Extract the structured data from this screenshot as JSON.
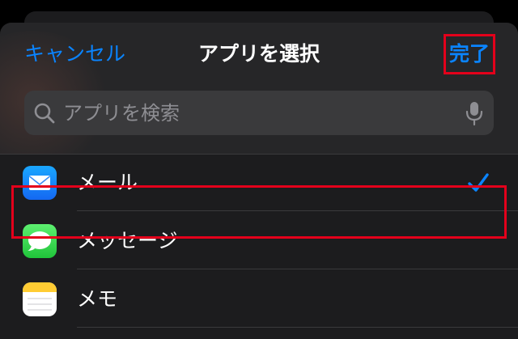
{
  "nav": {
    "cancel_label": "キャンセル",
    "title": "アプリを選択",
    "done_label": "完了"
  },
  "search": {
    "placeholder": "アプリを検索",
    "value": "",
    "icon": "search-icon",
    "mic_icon": "microphone-icon"
  },
  "apps": [
    {
      "label": "メール",
      "icon": "mail-app-icon",
      "selected": true
    },
    {
      "label": "メッセージ",
      "icon": "messages-app-icon",
      "selected": false
    },
    {
      "label": "メモ",
      "icon": "notes-app-icon",
      "selected": false
    }
  ],
  "colors": {
    "accent": "#0a84ff",
    "highlight": "#e3001b",
    "sheet_background": "#262628",
    "list_background": "#1c1c1e",
    "search_background": "#3a3a3c",
    "placeholder": "#8e8e93"
  }
}
